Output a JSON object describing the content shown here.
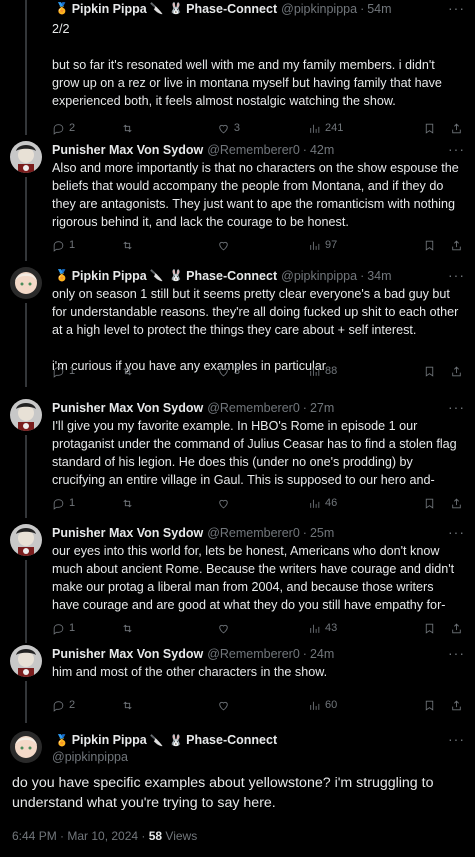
{
  "posts": [
    {
      "name": "Pipkin Pippa",
      "badges": [
        "🏅",
        "🔪",
        "🐰"
      ],
      "org": "Phase-Connect",
      "handle": "@pipkinpippa",
      "time": "54m",
      "text": "2/2\n\nbut so far it's resonated well with me and my family members. i didn't grow up on a rez or live in montana myself but having family that have experienced both, it feels almost nostalgic watching the show.",
      "replies": "2",
      "reposts": "",
      "likes": "3",
      "views": "241"
    },
    {
      "name": "Punisher Max Von Sydow",
      "handle": "@Rememberer0",
      "time": "42m",
      "text": "Also and more importantly is that no characters on the show espouse the beliefs that would accompany the people from Montana, and if they do they are antagonists. They just want to ape the romanticism with nothing rigorous behind it, and lack the courage to be honest.",
      "replies": "1",
      "reposts": "",
      "likes": "",
      "views": "97"
    },
    {
      "name": "Pipkin Pippa",
      "badges": [
        "🏅",
        "🔪",
        "🐰"
      ],
      "org": "Phase-Connect",
      "handle": "@pipkinpippa",
      "time": "34m",
      "text": "only on season 1 still but it seems pretty clear everyone's a bad guy but for understandable reasons. they're all doing fucked up shit to each other at a high level to protect the things they care about + self interest.\n\ni'm curious if you have any examples in particular",
      "replies": "1",
      "reposts": "",
      "likes": "3",
      "views": "88"
    },
    {
      "name": "Punisher Max Von Sydow",
      "handle": "@Rememberer0",
      "time": "27m",
      "text": "I'll give you my favorite example. In HBO's Rome in episode 1 our protaganist under the command of Julius Ceasar has to find a stolen flag standard of his legion. He does this (under no one's prodding) by crucifying an entire village in Gaul. This is supposed to our hero and-",
      "replies": "1",
      "reposts": "",
      "likes": "",
      "views": "46"
    },
    {
      "name": "Punisher Max Von Sydow",
      "handle": "@Rememberer0",
      "time": "25m",
      "text": "our eyes into this world for, lets be honest, Americans who don't know much about ancient Rome. Because the writers have courage and didn't make our protag a liberal man from 2004, and because those writers have courage and are good at what they do you still have empathy for-",
      "replies": "1",
      "reposts": "",
      "likes": "",
      "views": "43"
    },
    {
      "name": "Punisher Max Von Sydow",
      "handle": "@Rememberer0",
      "time": "24m",
      "text": "him and most of the other characters in the show.",
      "replies": "2",
      "reposts": "",
      "likes": "",
      "views": "60"
    }
  ],
  "main": {
    "name": "Pipkin Pippa",
    "badges": [
      "🏅",
      "🔪",
      "🐰"
    ],
    "org": "Phase-Connect",
    "handle": "@pipkinpippa",
    "text": "do you have specific examples about yellowstone? i'm struggling to understand what you're trying to say here.",
    "time": "6:44 PM · Mar 10, 2024 · ",
    "views_count": "58",
    "views_label": " Views"
  },
  "colors": {
    "muted": "#71767b",
    "text": "#e7e9ea",
    "line": "#333639"
  },
  "icons": {
    "reply": "reply-icon",
    "repost": "repost-icon",
    "like": "like-icon",
    "views": "views-icon",
    "bookmark": "bookmark-icon",
    "share": "share-icon",
    "more": "more-icon"
  }
}
